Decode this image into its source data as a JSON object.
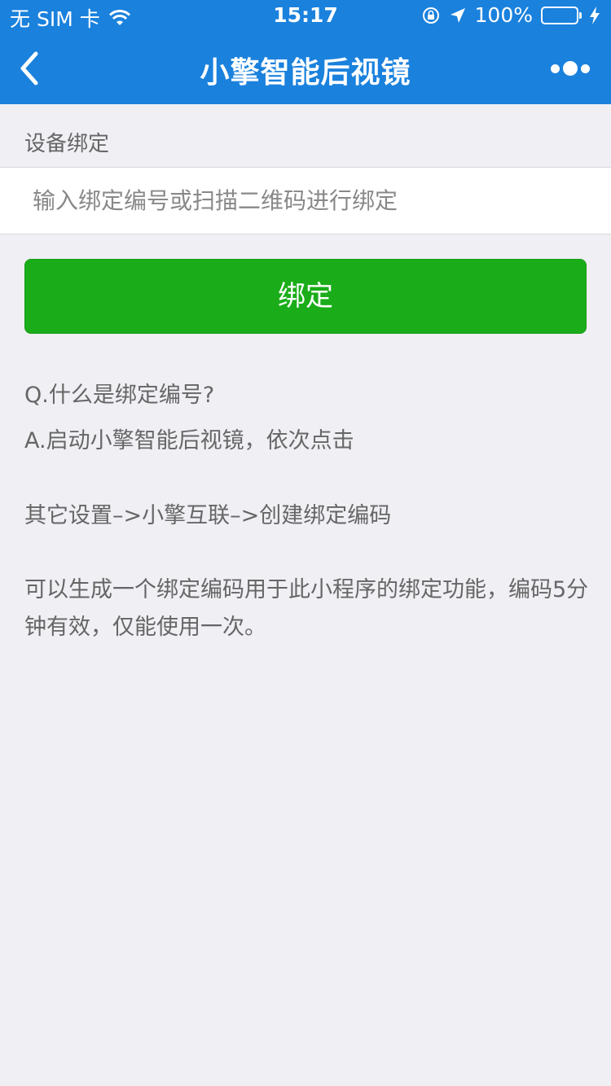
{
  "status_bar": {
    "carrier": "无 SIM 卡",
    "time": "15:17",
    "battery": "100%",
    "battery_level": 1.0,
    "icons": [
      "wifi-icon",
      "orientation-lock-icon",
      "location-arrow-icon",
      "battery-icon",
      "charging-bolt-icon"
    ]
  },
  "navbar": {
    "title": "小擎智能后视镜",
    "back_icon": "chevron-left-icon",
    "more_icon": "more-dots-icon"
  },
  "form": {
    "section_label": "设备绑定",
    "input_value": "",
    "input_placeholder": "输入绑定编号或扫描二维码进行绑定",
    "bind_button_label": "绑定"
  },
  "faq": {
    "question": "Q.什么是绑定编号?",
    "answer": "A.启动小擎智能后视镜，依次点击",
    "path": "其它设置–>小擎互联–>创建绑定编码",
    "description": "可以生成一个绑定编码用于此小程序的绑定功能，编码5分钟有效，仅能使用一次。"
  },
  "colors": {
    "primary_blue": "#1a81dd",
    "button_green": "#1aad19",
    "page_background": "#efeff4"
  }
}
